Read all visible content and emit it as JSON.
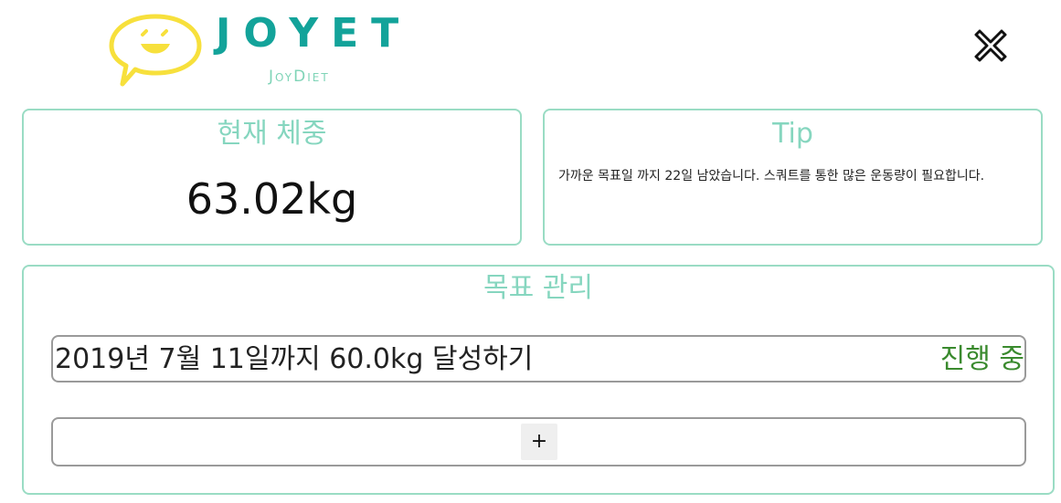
{
  "header": {
    "logo_title": "JOYET",
    "logo_subtitle": "JoyDiet",
    "logo_icon": "smiley-speech-bubble-icon",
    "close_icon": "close-icon",
    "colors": {
      "logo_title": "#13a39a",
      "logo_subtitle": "#7fd4b7",
      "bubble": "#f7e03c"
    }
  },
  "current_weight": {
    "title": "현재 체중",
    "value": "63.02kg"
  },
  "tip": {
    "title": "Tip",
    "text": "가까운 목표일 까지 22일 남았습니다. 스쿼트를 통한 많은 운동량이 필요합니다."
  },
  "goals": {
    "title": "목표 관리",
    "items": [
      {
        "text": "2019년 7월 11일까지 60.0kg 달성하기",
        "status": "진행 중"
      }
    ],
    "add_label": "+"
  },
  "colors": {
    "accent": "#86d6bf",
    "card_border": "#9adcc4",
    "status_in_progress": "#3a8a2e"
  }
}
